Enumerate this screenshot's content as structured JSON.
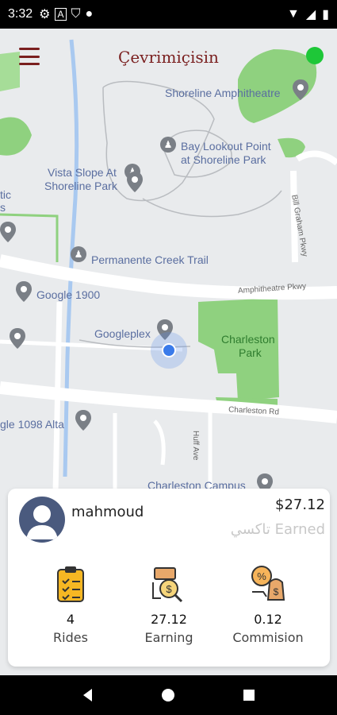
{
  "status_bar": {
    "time": "3:32"
  },
  "header": {
    "title": "Çevrimiçisin"
  },
  "map": {
    "labels": {
      "shoreline_amph": "Shoreline Amphitheatre",
      "bay_lookout_1": "Bay Lookout Point",
      "bay_lookout_2": "at Shoreline Park",
      "vista_1": "Vista Slope At",
      "vista_2": "Shoreline Park",
      "permanente": "Permanente Creek Trail",
      "google1900": "Google 1900",
      "googleplex": "Googleplex",
      "charleston_park_1": "Charleston",
      "charleston_park_2": "Park",
      "charleston_rd": "Charleston Rd",
      "amphitheatre_pkwy": "Amphitheatre Pkwy",
      "google1098": "gle 1098 Alta",
      "charleston_campus": "Charleston Campus",
      "huff_ave": "Huff Ave",
      "bill_graham": "Bill Graham Pkwy",
      "tic": "tic",
      "s": "s"
    }
  },
  "driver_card": {
    "username": "mahmoud",
    "amount": "$27.12",
    "earned_label": "تاكسي Earned",
    "stats": [
      {
        "value": "4",
        "label": "Rides",
        "icon": "clipboard-icon"
      },
      {
        "value": "27.12",
        "label": "Earning",
        "icon": "earning-icon"
      },
      {
        "value": "0.12",
        "label": "Commision",
        "icon": "commission-icon"
      }
    ]
  },
  "colors": {
    "accent": "#7a1f1f",
    "online": "#1ec738",
    "park_green": "#8fd17f"
  }
}
